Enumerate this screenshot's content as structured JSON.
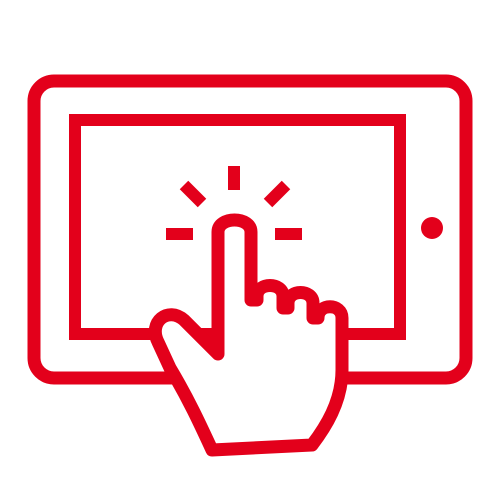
{
  "icon": {
    "name": "tablet-tap-icon",
    "parts": [
      "tablet-frame-icon",
      "tablet-screen-icon",
      "home-button-icon",
      "tap-burst-icon",
      "pointing-hand-icon"
    ]
  },
  "colors": {
    "accent": "#E3001B",
    "background": "#FFFFFF"
  }
}
